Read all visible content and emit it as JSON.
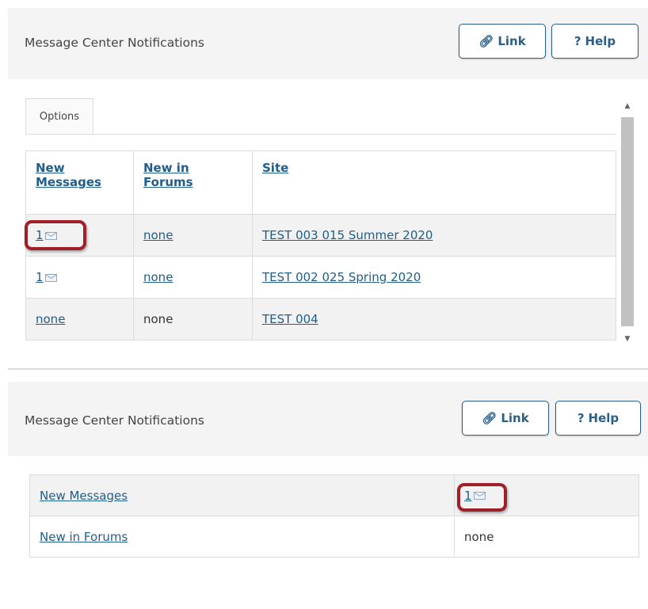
{
  "panel1": {
    "title": "Message Center Notifications",
    "link_label": "Link",
    "help_label": "Help",
    "tab_label": "Options",
    "headers": [
      "New Messages",
      "New in Forums",
      "Site"
    ],
    "rows": [
      {
        "messages": "1",
        "forums": "none",
        "site": "TEST 003 015 Summer 2020"
      },
      {
        "messages": "1",
        "forums": "none",
        "site": "TEST 002 025 Spring 2020"
      },
      {
        "messages": "none",
        "forums": "none",
        "site": "TEST 004"
      }
    ]
  },
  "panel2": {
    "title": "Message Center Notifications",
    "link_label": "Link",
    "help_label": "Help",
    "rows": [
      {
        "label": "New Messages",
        "value": "1"
      },
      {
        "label": "New in Forums",
        "value": "none"
      }
    ]
  },
  "icons": {
    "link": "link-icon",
    "help": "question-mark-icon",
    "mail": "envelope-icon"
  },
  "colors": {
    "link": "#1f5d8a",
    "highlight": "#a0202a",
    "header_bg": "#f4f4f4"
  }
}
